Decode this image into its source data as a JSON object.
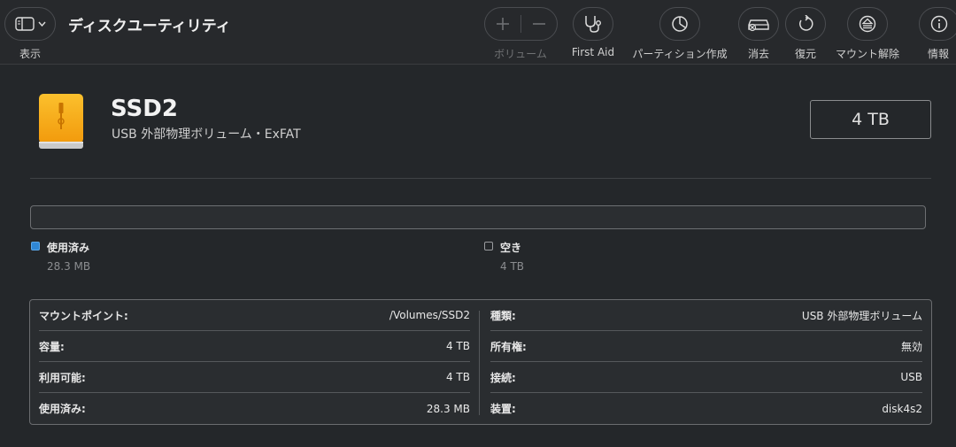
{
  "window": {
    "title": "ディスクユーティリティ"
  },
  "toolbar": {
    "view_label": "表示",
    "volume_label": "ボリューム",
    "first_aid_label": "First Aid",
    "partition_label": "パーティション作成",
    "erase_label": "消去",
    "restore_label": "復元",
    "unmount_label": "マウント解除",
    "info_label": "情報"
  },
  "disk": {
    "name": "SSD2",
    "description": "USB 外部物理ボリューム・ExFAT",
    "capacity": "4 TB"
  },
  "usage": {
    "used_fraction": 7e-06,
    "used_label": "使用済み",
    "used_value": "28.3 MB",
    "free_label": "空き",
    "free_value": "4 TB",
    "used_color": "#2f87d6"
  },
  "info": {
    "left": [
      {
        "key": "マウントポイント:",
        "value": "/Volumes/SSD2"
      },
      {
        "key": "容量:",
        "value": "4 TB"
      },
      {
        "key": "利用可能:",
        "value": "4 TB"
      },
      {
        "key": "使用済み:",
        "value": "28.3 MB"
      }
    ],
    "right": [
      {
        "key": "種類:",
        "value": "USB 外部物理ボリューム"
      },
      {
        "key": "所有権:",
        "value": "無効"
      },
      {
        "key": "接続:",
        "value": "USB"
      },
      {
        "key": "装置:",
        "value": "disk4s2"
      }
    ]
  }
}
